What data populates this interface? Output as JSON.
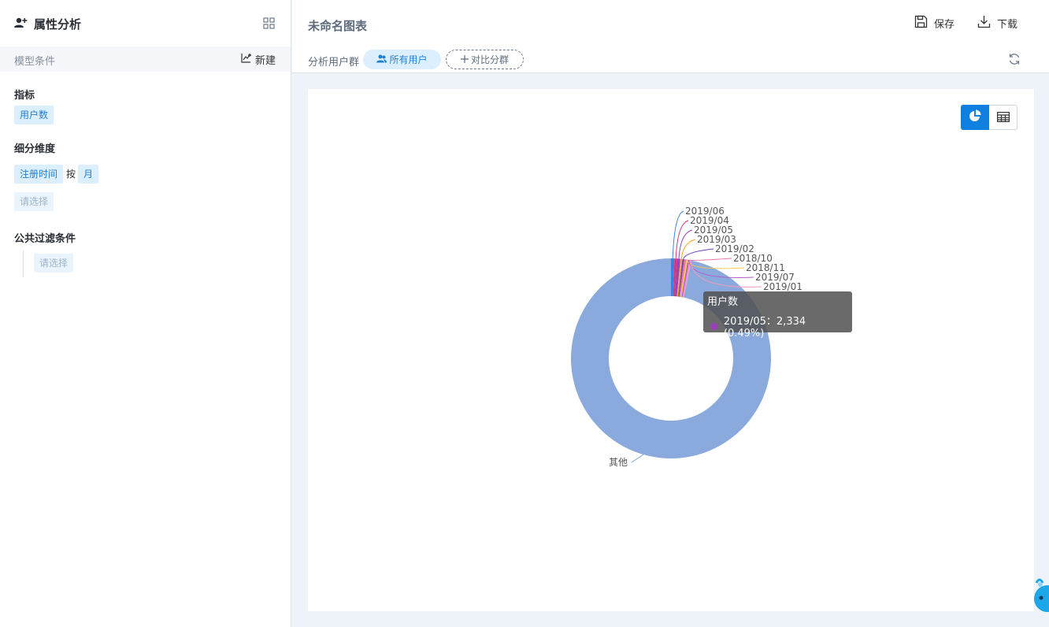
{
  "sidebar": {
    "title": "属性分析",
    "model_label": "模型条件",
    "new_label": "新建",
    "metric_title": "指标",
    "metric_tag": "用户数",
    "dimension_title": "细分维度",
    "dimension_tag": "注册时间",
    "by_label": "按",
    "granularity_tag": "月",
    "dimension_placeholder": "请选择",
    "filter_title": "公共过滤条件",
    "filter_placeholder": "请选择"
  },
  "topbar": {
    "chart_title": "未命名图表",
    "save_label": "保存",
    "download_label": "下载",
    "group_label": "分析用户群",
    "all_users_label": "所有用户",
    "compare_label": "对比分群"
  },
  "icons": {
    "header": "user-plus-icon",
    "grid": "grid-icon",
    "new": "chart-add-icon",
    "save": "save-icon",
    "download": "download-icon",
    "users": "users-icon",
    "plus": "plus-icon",
    "refresh": "refresh-icon",
    "pie_view": "pie-chart-icon",
    "table_view": "table-icon"
  },
  "chart_data": {
    "type": "pie",
    "variant": "donut",
    "metric": "用户数",
    "slices": [
      {
        "name": "2019/06",
        "color": "#3a83e0"
      },
      {
        "name": "2019/04",
        "color": "#d6367a"
      },
      {
        "name": "2019/05",
        "color": "#9c3fbd",
        "value": 2334,
        "percent": "0.49%"
      },
      {
        "name": "2019/03",
        "color": "#f5a623"
      },
      {
        "name": "2019/02",
        "color": "#6f42c1"
      },
      {
        "name": "2018/10",
        "color": "#ef6fa5"
      },
      {
        "name": "2018/11",
        "color": "#f2c94c"
      },
      {
        "name": "2019/07",
        "color": "#b35fd1"
      },
      {
        "name": "2019/01",
        "color": "#f39bb8"
      },
      {
        "name": "其他",
        "color": "#8aa9dd"
      }
    ],
    "tooltip": {
      "title": "用户数",
      "text": "2019/05：2,334 (0.49%)"
    }
  }
}
